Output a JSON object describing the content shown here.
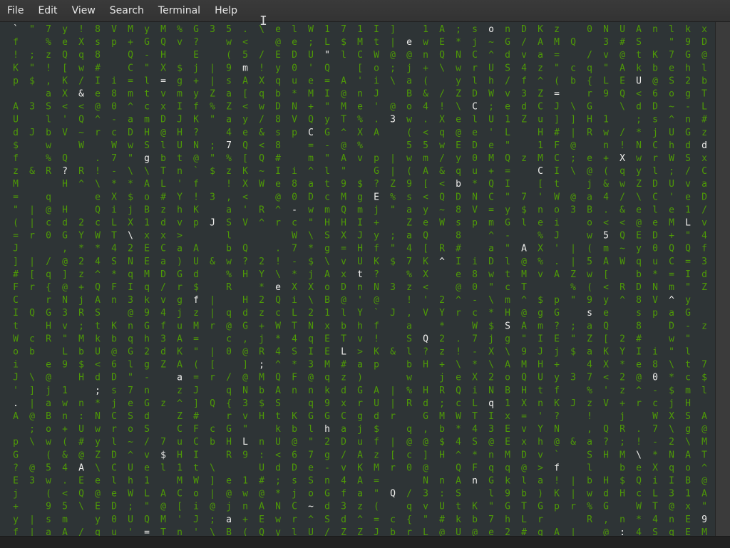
{
  "menu": [
    "File",
    "Edit",
    "View",
    "Search",
    "Terminal",
    "Help"
  ],
  "terminal": {
    "columns": [
      {
        "head": "",
        "chars": "`f!Kp AUd$fzM=\"(=J]#FCItWoiJ'.A pG?Ej+yfK?N@"
      },
      {
        "head": "",
        "chars": "3  ||Z%\" ;\"$ 3 J  &  ||r |[r Q cb \\]|@;\\ @"
      },
      {
        "head": "G",
        "chars": "aBow(5w(9saZa47%z!,aSlbw%R q@c0 /q{rGHR e@j"
      },
      {
        "head": "Q",
        "chars": "N3v\"L9 1wn+(&4.<5mA[<yeQ[KX<'V Q?H HdG,@]@"
      },
      {
        "head": "B",
        "chars": "^  2Y*2z+jR;Mb$H n:U#@AEQ\\ /!Xqw/&<Q~W R"
      },
      {
        "head": "o",
        "chars": "^r .!\\eQcW*4^QAStkU<d;*NwyZ\\e@EyqbD8s8#Ie@"
      },
      {
        "head": "*",
        "chars": "Vp  i80-cW7-*XiLT4S*Fn Kb@6DsjCrlDCleD0u*N"
      },
      {
        "head": "u",
        "chars": "^UhW;U'eM+QC=m^aDw\"\\*$jX\\2NqI3@nqGl\"7eSo~"
      },
      {
        "head": "0",
        "chars": "nGdS/ve1L\"Q=I\"yG-\"ltcmHSg\\AoB1xEEMqk9Gh2g-"
      },
      {
        "head": "g",
        "chars": "  z  7$l A@MT^@A\"9MQHX=vxD@lbTL#zdxCaD/v4f3dZ"
      },
      {
        "head": "\"",
        "chars": ">a)GrgjuAKAaz^ZCuH1MC['ne%X%v $gmIJHUtn'Yhv"
      }
    ],
    "rain_color": "#4e9a06",
    "highlight_color": "#eeeeec",
    "background": "#2e3436"
  }
}
